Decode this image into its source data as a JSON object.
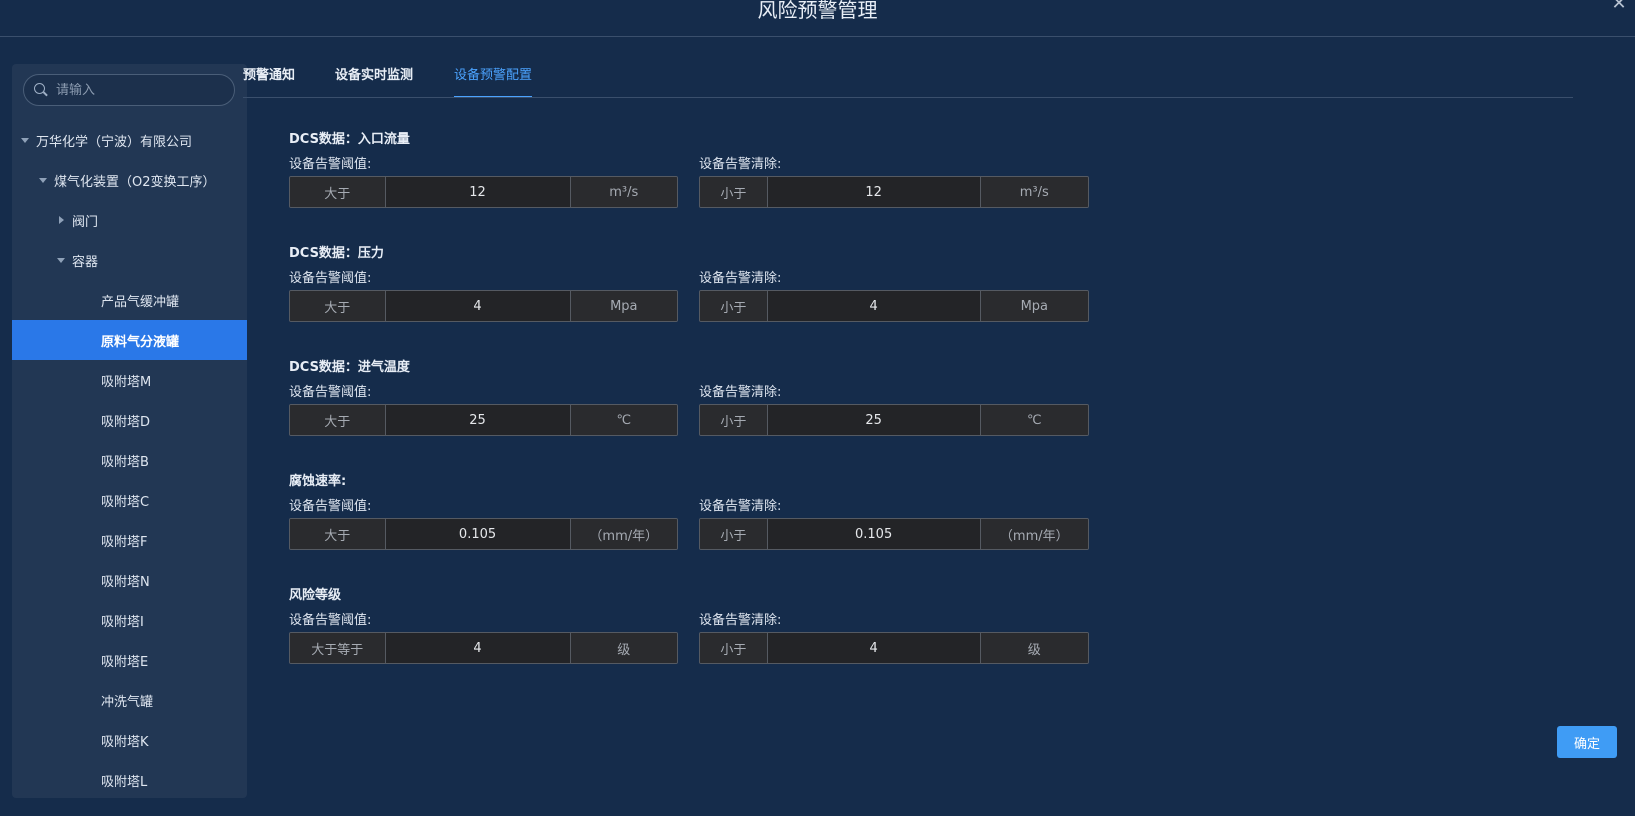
{
  "dialog": {
    "title": "风险预警管理",
    "close_glyph": "✕"
  },
  "search": {
    "placeholder": "请输入"
  },
  "tree": [
    {
      "label": "万华化学（宁波）有限公司",
      "level": 0,
      "caret": "down",
      "selected": false
    },
    {
      "label": "煤气化装置（O2变换工序）",
      "level": 1,
      "caret": "down",
      "selected": false
    },
    {
      "label": "阀门",
      "level": 2,
      "caret": "right",
      "selected": false
    },
    {
      "label": "容器",
      "level": 2,
      "caret": "down",
      "selected": false
    },
    {
      "label": "产品气缓冲罐",
      "level": 3,
      "caret": "none",
      "selected": false
    },
    {
      "label": "原料气分液罐",
      "level": 3,
      "caret": "none",
      "selected": true
    },
    {
      "label": "吸附塔M",
      "level": 3,
      "caret": "none",
      "selected": false
    },
    {
      "label": "吸附塔D",
      "level": 3,
      "caret": "none",
      "selected": false
    },
    {
      "label": "吸附塔B",
      "level": 3,
      "caret": "none",
      "selected": false
    },
    {
      "label": "吸附塔C",
      "level": 3,
      "caret": "none",
      "selected": false
    },
    {
      "label": "吸附塔F",
      "level": 3,
      "caret": "none",
      "selected": false
    },
    {
      "label": "吸附塔N",
      "level": 3,
      "caret": "none",
      "selected": false
    },
    {
      "label": "吸附塔I",
      "level": 3,
      "caret": "none",
      "selected": false
    },
    {
      "label": "吸附塔E",
      "level": 3,
      "caret": "none",
      "selected": false
    },
    {
      "label": "冲洗气罐",
      "level": 3,
      "caret": "none",
      "selected": false
    },
    {
      "label": "吸附塔K",
      "level": 3,
      "caret": "none",
      "selected": false
    },
    {
      "label": "吸附塔L",
      "level": 3,
      "caret": "none",
      "selected": false
    }
  ],
  "tabs": [
    {
      "label": "预警通知",
      "active": false
    },
    {
      "label": "设备实时监测",
      "active": false
    },
    {
      "label": "设备预警配置",
      "active": true
    }
  ],
  "sections": [
    {
      "title": "DCS数据：入口流量",
      "threshold": {
        "label": "设备告警阈值:",
        "op": "大于",
        "value": "12",
        "unit": "m³/s"
      },
      "clear": {
        "label": "设备告警清除:",
        "op": "小于",
        "value": "12",
        "unit": "m³/s"
      }
    },
    {
      "title": "DCS数据：压力",
      "threshold": {
        "label": "设备告警阈值:",
        "op": "大于",
        "value": "4",
        "unit": "Mpa"
      },
      "clear": {
        "label": "设备告警清除:",
        "op": "小于",
        "value": "4",
        "unit": "Mpa"
      }
    },
    {
      "title": "DCS数据：进气温度",
      "threshold": {
        "label": "设备告警阈值:",
        "op": "大于",
        "value": "25",
        "unit": "℃"
      },
      "clear": {
        "label": "设备告警清除:",
        "op": "小于",
        "value": "25",
        "unit": "℃"
      }
    },
    {
      "title": "腐蚀速率:",
      "threshold": {
        "label": "设备告警阈值:",
        "op": "大于",
        "value": "0.105",
        "unit": "（mm/年）"
      },
      "clear": {
        "label": "设备告警清除:",
        "op": "小于",
        "value": "0.105",
        "unit": "（mm/年）"
      }
    },
    {
      "title": "风险等级",
      "threshold": {
        "label": "设备告警阈值:",
        "op": "大于等于",
        "value": "4",
        "unit": "级"
      },
      "clear": {
        "label": "设备告警清除:",
        "op": "小于",
        "value": "4",
        "unit": "级"
      }
    }
  ],
  "footer": {
    "confirm_label": "确定"
  },
  "colors": {
    "background": "#152c4b",
    "sidebar": "#223754",
    "accent": "#2a78e8",
    "tab_active": "#4ba3ff",
    "button": "#3f9cf5"
  }
}
